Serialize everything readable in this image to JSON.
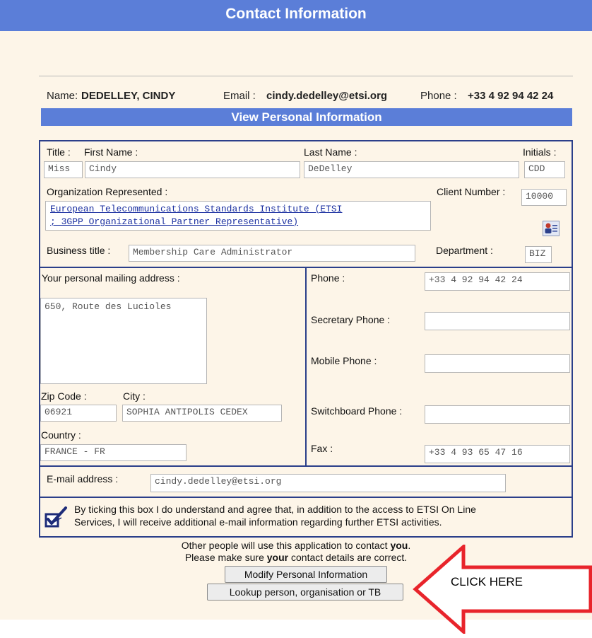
{
  "header": {
    "title": "Contact Information"
  },
  "summary": {
    "name_label": "Name:",
    "name_value": "DEDELLEY, CINDY",
    "email_label": "Email :",
    "email_value": "cindy.dedelley@etsi.org",
    "phone_label": "Phone :",
    "phone_value": "+33 4 92 94 42 24"
  },
  "view_personal_label": "View Personal Information",
  "personal": {
    "title_label": "Title :",
    "first_name_label": "First Name :",
    "last_name_label": "Last Name :",
    "initials_label": "Initials :",
    "title_value": "Miss",
    "first_name_value": "Cindy",
    "last_name_value": "DeDelley",
    "initials_value": "CDD",
    "org_label": "Organization Represented :",
    "org_line1": "European Telecommunications Standards Institute (ETSI",
    "org_line2": "; 3GPP Organizational Partner Representative)",
    "client_number_label": "Client Number :",
    "client_number_value": "10000",
    "business_title_label": "Business title :",
    "business_title_value": "Membership Care Administrator",
    "department_label": "Department :",
    "department_value": "BIZ"
  },
  "address": {
    "mailing_label": "Your personal mailing address :",
    "mailing_value": "650, Route des Lucioles",
    "zip_label": "Zip Code :",
    "zip_value": "06921",
    "city_label": "City :",
    "city_value": "SOPHIA ANTIPOLIS CEDEX",
    "country_label": "Country :",
    "country_value": "FRANCE - FR"
  },
  "phones": {
    "phone_label": "Phone :",
    "phone_value": "+33 4 92 94 42 24",
    "secretary_label": "Secretary Phone :",
    "secretary_value": "",
    "mobile_label": "Mobile Phone :",
    "mobile_value": "",
    "switchboard_label": "Switchboard Phone :",
    "switchboard_value": "",
    "fax_label": "Fax :",
    "fax_value": "+33 4 93 65 47 16"
  },
  "email": {
    "label": "E-mail address :",
    "value": "cindy.dedelley@etsi.org"
  },
  "agreement": {
    "checked": true,
    "line1": "By ticking this box I do understand and agree that, in addition to the access to ETSI On Line",
    "line2": "Services, I will receive additional e-mail information regarding further ETSI activities."
  },
  "notes": {
    "line1_prefix": "Other people will use this application to contact ",
    "line1_bold": "you",
    "line1_suffix": ".",
    "line2_prefix": "Please make sure ",
    "line2_bold": "your",
    "line2_suffix": " contact details are correct."
  },
  "buttons": {
    "modify": "Modify Personal Information",
    "lookup": "Lookup person, organisation or TB"
  },
  "callout": {
    "text": "CLICK HERE"
  },
  "colors": {
    "header_blue": "#5b7ed8",
    "frame_navy": "#2b3f8a",
    "background_cream": "#fdf5e8",
    "arrow_red": "#e8242b"
  },
  "icons": {
    "contact_card": "contact-card-icon",
    "checkbox": "checkbox-checked-icon",
    "arrow": "arrow-left-icon"
  }
}
